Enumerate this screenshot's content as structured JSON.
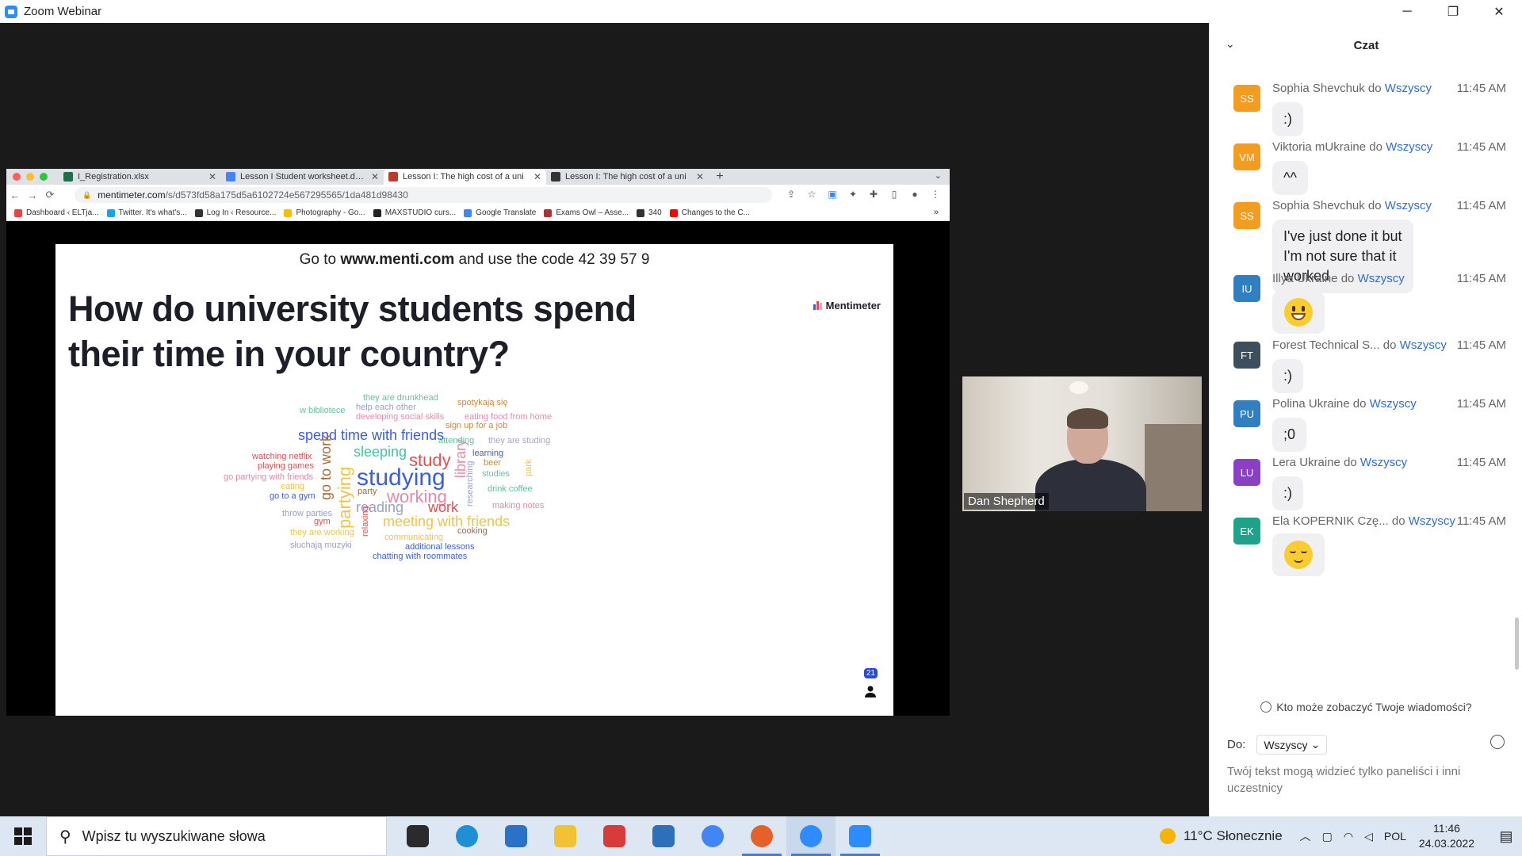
{
  "window": {
    "title": "Zoom Webinar",
    "controls": [
      "─",
      "❐",
      "✕"
    ]
  },
  "browser": {
    "tabs": [
      {
        "label": "I_Registration.xlsx",
        "color": "#1e7145"
      },
      {
        "label": "Lesson I Student worksheet.docx",
        "color": "#4285f4"
      },
      {
        "label": "Lesson I: The high cost of a uni",
        "color": "#c0392b"
      },
      {
        "label": "Lesson I: The high cost of a uni",
        "color": "#333333"
      }
    ],
    "url_host": "mentimeter.com",
    "url_path": "/s/d573fd58a175d5a6102724e567295565/1da481d98430",
    "bookmarks": [
      {
        "label": "Dashboard ‹ ELTja...",
        "color": "#e8453c"
      },
      {
        "label": "Twitter. It's what's...",
        "color": "#1da1f2"
      },
      {
        "label": "Log In ‹ Resource...",
        "color": "#333333"
      },
      {
        "label": "Photography - Go...",
        "color": "#fbbc05"
      },
      {
        "label": "MAXSTUDIO curs...",
        "color": "#222222"
      },
      {
        "label": "Google Translate",
        "color": "#4285f4"
      },
      {
        "label": "Exams Owl – Asse...",
        "color": "#a33"
      },
      {
        "label": "340",
        "color": "#333333"
      },
      {
        "label": "Changes to the C...",
        "color": "#ff0000"
      }
    ]
  },
  "slide": {
    "code_prefix": "Go to ",
    "code_site": "www.menti.com",
    "code_mid": " and use the code ",
    "code_value": "42 39 57 9",
    "question": "How do university students spend their time in your country?",
    "logo": "Mentimeter",
    "participants": "21"
  },
  "wordcloud": [
    {
      "t": "they are drunkhead",
      "c": "#64c49a",
      "s": 11,
      "v": false
    },
    {
      "t": "help each other",
      "c": "#9aa0c8",
      "s": 11,
      "v": false
    },
    {
      "t": "spotykają się",
      "c": "#d08a3a",
      "s": 11,
      "v": false
    },
    {
      "t": "w bibliotece",
      "c": "#64c49a",
      "s": 11,
      "v": false
    },
    {
      "t": "developing social skills",
      "c": "#e88aa8",
      "s": 11,
      "v": false
    },
    {
      "t": "eating food from home",
      "c": "#e88aa8",
      "s": 11,
      "v": false
    },
    {
      "t": "sign up for a job",
      "c": "#d08a3a",
      "s": 11,
      "v": false
    },
    {
      "t": "spend time with friends",
      "c": "#3b5fd9",
      "s": 18,
      "v": false
    },
    {
      "t": "attending",
      "c": "#64c49a",
      "s": 11,
      "v": false
    },
    {
      "t": "they are studing",
      "c": "#a7a7c9",
      "s": 11,
      "v": false
    },
    {
      "t": "sleeping",
      "c": "#3fc4a7",
      "s": 18,
      "v": false
    },
    {
      "t": "study",
      "c": "#e0504f",
      "s": 22,
      "v": false
    },
    {
      "t": "learning",
      "c": "#3b5fd9",
      "s": 11,
      "v": false
    },
    {
      "t": "watching netflix",
      "c": "#e0504f",
      "s": 11,
      "v": false
    },
    {
      "t": "beer",
      "c": "#d08a3a",
      "s": 11,
      "v": false
    },
    {
      "t": "playing games",
      "c": "#e0504f",
      "s": 11,
      "v": false
    },
    {
      "t": "studying",
      "c": "#3b5fd9",
      "s": 30,
      "v": false
    },
    {
      "t": "studies",
      "c": "#64c49a",
      "s": 11,
      "v": false
    },
    {
      "t": "go partying with friends",
      "c": "#e88aa8",
      "s": 11,
      "v": false
    },
    {
      "t": "eating",
      "c": "#f0c34a",
      "s": 11,
      "v": false
    },
    {
      "t": "working",
      "c": "#e88aa8",
      "s": 22,
      "v": false
    },
    {
      "t": "party",
      "c": "#a36a3a",
      "s": 11,
      "v": false
    },
    {
      "t": "drink coffee",
      "c": "#64c49a",
      "s": 11,
      "v": false
    },
    {
      "t": "go to a gym",
      "c": "#3b5fd9",
      "s": 11,
      "v": false
    },
    {
      "t": "reading",
      "c": "#9aa0c8",
      "s": 18,
      "v": false
    },
    {
      "t": "work",
      "c": "#e0504f",
      "s": 18,
      "v": false
    },
    {
      "t": "making notes",
      "c": "#e88aa8",
      "s": 11,
      "v": false
    },
    {
      "t": "throw parties",
      "c": "#9aa0c8",
      "s": 11,
      "v": false
    },
    {
      "t": "meeting with friends",
      "c": "#f0c34a",
      "s": 18,
      "v": false
    },
    {
      "t": "gym",
      "c": "#e0504f",
      "s": 11,
      "v": false
    },
    {
      "t": "they are working",
      "c": "#f0c34a",
      "s": 11,
      "v": false
    },
    {
      "t": "cooking",
      "c": "#a36a3a",
      "s": 11,
      "v": false
    },
    {
      "t": "communicating",
      "c": "#f0c34a",
      "s": 11,
      "v": false
    },
    {
      "t": "słuchają muzyki",
      "c": "#9aa0c8",
      "s": 11,
      "v": false
    },
    {
      "t": "additional lessons",
      "c": "#3b5fd9",
      "s": 11,
      "v": false
    },
    {
      "t": "chatting with roommates",
      "c": "#3b5fd9",
      "s": 11,
      "v": false
    },
    {
      "t": "go to work",
      "c": "#a36a3a",
      "s": 18,
      "v": true
    },
    {
      "t": "partying",
      "c": "#f0c34a",
      "s": 22,
      "v": true
    },
    {
      "t": "library",
      "c": "#e88aa8",
      "s": 18,
      "v": true
    },
    {
      "t": "researching",
      "c": "#9aa0c8",
      "s": 11,
      "v": true
    },
    {
      "t": "park",
      "c": "#f0c34a",
      "s": 11,
      "v": true
    },
    {
      "t": "relaxing",
      "c": "#e0504f",
      "s": 11,
      "v": true
    }
  ],
  "video": {
    "name": "Dan Shepherd"
  },
  "chat": {
    "title": "Czat",
    "messages": [
      {
        "initials": "SS",
        "color": "#f29d1f",
        "sender": "Sophia Shevchuk",
        "to": "Wszyscy",
        "time": "11:45 AM",
        "text": ":)",
        "emoji": ""
      },
      {
        "initials": "VM",
        "color": "#f29d1f",
        "sender": "Viktoria mUkraine",
        "to": "Wszyscy",
        "time": "11:45 AM",
        "text": "^^",
        "emoji": ""
      },
      {
        "initials": "SS",
        "color": "#f29d1f",
        "sender": "Sophia Shevchuk",
        "to": "Wszyscy",
        "time": "11:45 AM",
        "text": "I've just done it but I'm not sure that it worked",
        "emoji": ""
      },
      {
        "initials": "IU",
        "color": "#2f7fc1",
        "sender": "Illya Ukraine",
        "to": "Wszyscy",
        "time": "11:45 AM",
        "text": "",
        "emoji": "grinning-face"
      },
      {
        "initials": "FT",
        "color": "#3d4f5c",
        "sender": "Forest Technical S...",
        "to": "Wszyscy",
        "time": "11:45 AM",
        "text": ":)",
        "emoji": ""
      },
      {
        "initials": "PU",
        "color": "#2f7fc1",
        "sender": "Polina Ukraine",
        "to": "Wszyscy",
        "time": "11:45 AM",
        "text": ";0",
        "emoji": ""
      },
      {
        "initials": "LU",
        "color": "#8a3fc4",
        "sender": "Lera Ukraine",
        "to": "Wszyscy",
        "time": "11:45 AM",
        "text": ":)",
        "emoji": ""
      },
      {
        "initials": "EK",
        "color": "#1ea38a",
        "sender": "Ela KOPERNIK Czę...",
        "to": "Wszyscy",
        "time": "11:45 AM",
        "text": "",
        "emoji": "relieved-face"
      }
    ],
    "to_word": "do",
    "who_can_see": "Kto może zobaczyć Twoje wiadomości?",
    "to_label": "Do:",
    "recipient": "Wszyscy",
    "input_placeholder": "Twój tekst mogą widzieć tylko paneliści i inni uczestnicy"
  },
  "taskbar": {
    "search_placeholder": "Wpisz tu wyszukiwane słowa",
    "apps": [
      {
        "name": "task-view",
        "color": "#2b2b2b",
        "running": false,
        "active": false
      },
      {
        "name": "edge",
        "color": "#1f8fd6",
        "running": false,
        "active": false
      },
      {
        "name": "mail",
        "color": "#2a72c8",
        "running": false,
        "active": false
      },
      {
        "name": "file-explorer",
        "color": "#f2c234",
        "running": false,
        "active": false
      },
      {
        "name": "gift",
        "color": "#d83b3b",
        "running": false,
        "active": false
      },
      {
        "name": "store",
        "color": "#2d6fb8",
        "running": false,
        "active": false
      },
      {
        "name": "chrome",
        "color": "#4285f4",
        "running": false,
        "active": false
      },
      {
        "name": "firefox",
        "color": "#e6602a",
        "running": true,
        "active": false
      },
      {
        "name": "zoom-meetings",
        "color": "#2d8cff",
        "running": true,
        "active": true
      },
      {
        "name": "zoom",
        "color": "#2d8cff",
        "running": true,
        "active": false
      }
    ],
    "weather": "11°C  Słonecznie",
    "lang": "POL",
    "time": "11:46",
    "date": "24.03.2022"
  }
}
